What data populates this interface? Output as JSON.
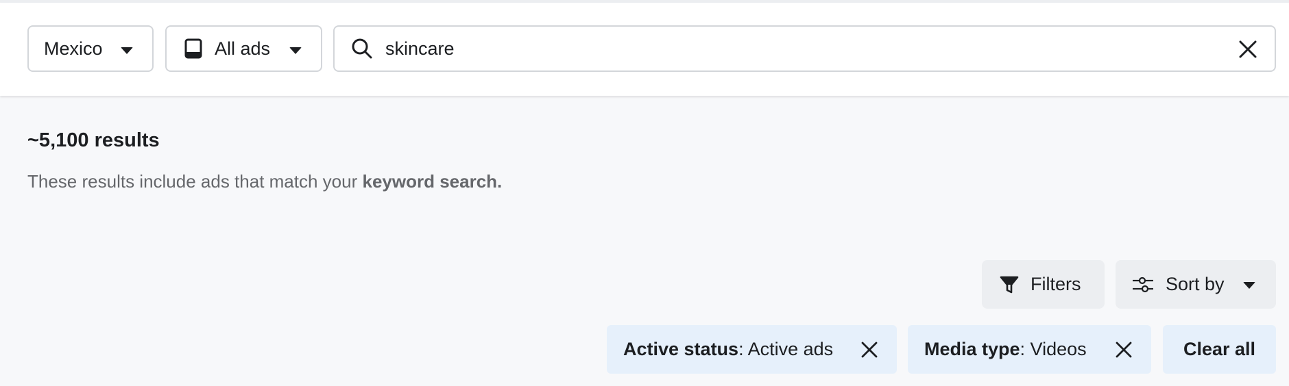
{
  "search_bar": {
    "country": {
      "label": "Mexico",
      "icon": "chevron-down-icon"
    },
    "ad_category": {
      "label": "All ads",
      "icon": "tablet-icon"
    },
    "search": {
      "value": "skincare",
      "icon": "search-icon",
      "clear_icon": "close-icon"
    }
  },
  "results": {
    "count": "~5,100 results",
    "description_prefix": "These results include ads that match your",
    "description_emphasis": "keyword search."
  },
  "actions": {
    "filters_label": "Filters",
    "sort_label": "Sort by"
  },
  "active_filters": [
    {
      "key": "Active status",
      "value": ": Active ads"
    },
    {
      "key": "Media type",
      "value": ": Videos"
    }
  ],
  "clear_all_label": "Clear all",
  "colors": {
    "chip_background": "#e6f0fb",
    "button_background": "#eceef1",
    "border": "#d3d6da",
    "text_primary": "#1c1e21",
    "text_secondary": "#65676b"
  }
}
